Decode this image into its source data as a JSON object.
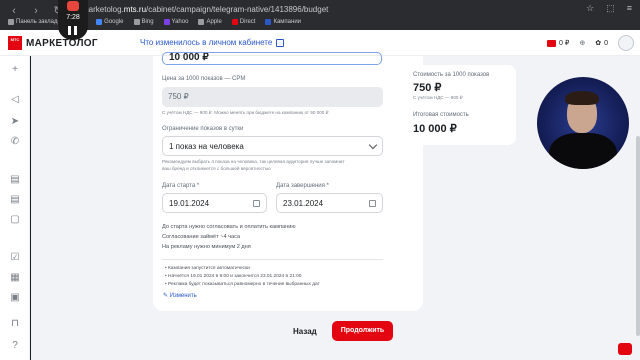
{
  "browser": {
    "url_prefix": "marketolog.",
    "url_domain": "mts.ru",
    "url_path": "/cabinet/campaign/telegram-native/1413896/budget",
    "bookmarks": [
      {
        "label": "Панель закладок",
        "color": "#9a9ca1"
      },
      {
        "label": "G",
        "color": "#4285f4"
      },
      {
        "label": "Google",
        "color": "#4285f4"
      },
      {
        "label": "Bing",
        "color": "#9a9ca1"
      },
      {
        "label": "Yahoo",
        "color": "#7b3fe4"
      },
      {
        "label": "Apple",
        "color": "#9a9ca1"
      },
      {
        "label": "Direct",
        "color": "#e30611"
      },
      {
        "label": "Кампании",
        "color": "#2a59c7"
      }
    ]
  },
  "recorder": {
    "time": "7:28"
  },
  "header": {
    "logo_text": "МАРКЕТОЛОГ",
    "logo_mark": "МТС",
    "whats_new": "Что изменилось в личном кабинете",
    "balance": "0 ₽",
    "bonus": "0"
  },
  "form": {
    "top_value": "10 000 ₽",
    "cpm_label": "Цена за 1000 показов — CPM",
    "cpm_value": "750 ₽",
    "cpm_hint": "С учётом НДС — 900 ₽. Можно менять при бюджете на кампанию от 50 000 ₽",
    "limit_label": "Ограничение показов в сутки",
    "limit_value": "1 показ на человека",
    "limit_hint_1": "Рекомендуем выбрать 4 показа на человека, так целевая аудитория лучше запомнит",
    "limit_hint_2": "ваш бренд и откликнется с большей вероятностью",
    "start_label": "Дата старта *",
    "start_value": "19.01.2024",
    "end_label": "Дата завершения *",
    "end_value": "23.01.2024",
    "note_1": "До старта нужно согласовать и оплатить кампанию",
    "note_2": "Согласование займёт ~4 часа",
    "note_3": "На рекламу нужно минимум 2 дня",
    "bullets": [
      "Кампания запустится автоматически",
      "Начнётся 19.01.2024 в 9:00 и закончится 23.01.2024 в 21:00",
      "Реклама будет показываться равномерно в течение выбранных дат"
    ],
    "edit_link": "Изменить"
  },
  "summary": {
    "cpm_label": "Стоимость за 1000 показов",
    "cpm_value": "750 ₽",
    "cpm_vat": "С учётом НДС — 900 ₽",
    "total_label": "Итоговая стоимость",
    "total_value": "10 000 ₽"
  },
  "actions": {
    "back": "Назад",
    "next": "Продолжить"
  }
}
